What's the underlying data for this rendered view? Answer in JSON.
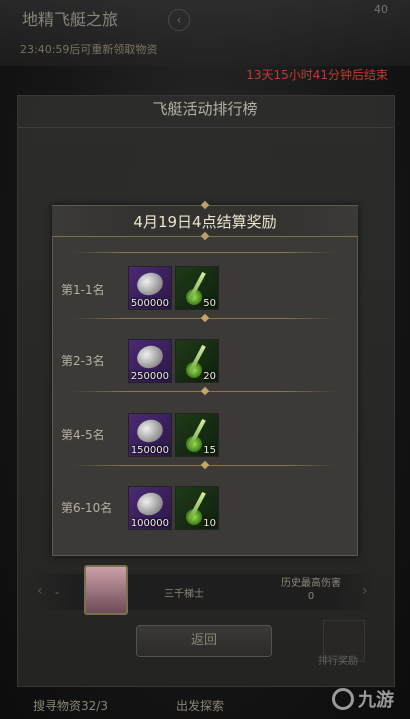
{
  "background": {
    "event_title": "地精飞艇之旅",
    "refresh_text": "23:40:59后可重新领取物资",
    "counter": "40",
    "countdown": "13天15小时41分钟后结束",
    "panel_title": "飞艇活动排行榜",
    "player": {
      "dash": "-",
      "name": "三千梯士",
      "history_label": "历史最高伤害",
      "history_value": "0"
    },
    "return_label": "返回",
    "rank_reward_label": "排行奖励",
    "bottom_left": "搜寻物资32/3",
    "bottom_mid": "出发探索",
    "logo": "九游"
  },
  "popup": {
    "title": "4月19日4点结算奖励",
    "rows": [
      {
        "label": "第1-1名",
        "coin": "500000",
        "sword": "50"
      },
      {
        "label": "第2-3名",
        "coin": "250000",
        "sword": "20"
      },
      {
        "label": "第4-5名",
        "coin": "150000",
        "sword": "15"
      },
      {
        "label": "第6-10名",
        "coin": "100000",
        "sword": "10"
      }
    ]
  },
  "colors": {
    "accent_gold": "#8a7648",
    "countdown_red": "#c23a33",
    "coin_bg": "#4b2a73",
    "sword_bg": "#1f3a18"
  }
}
